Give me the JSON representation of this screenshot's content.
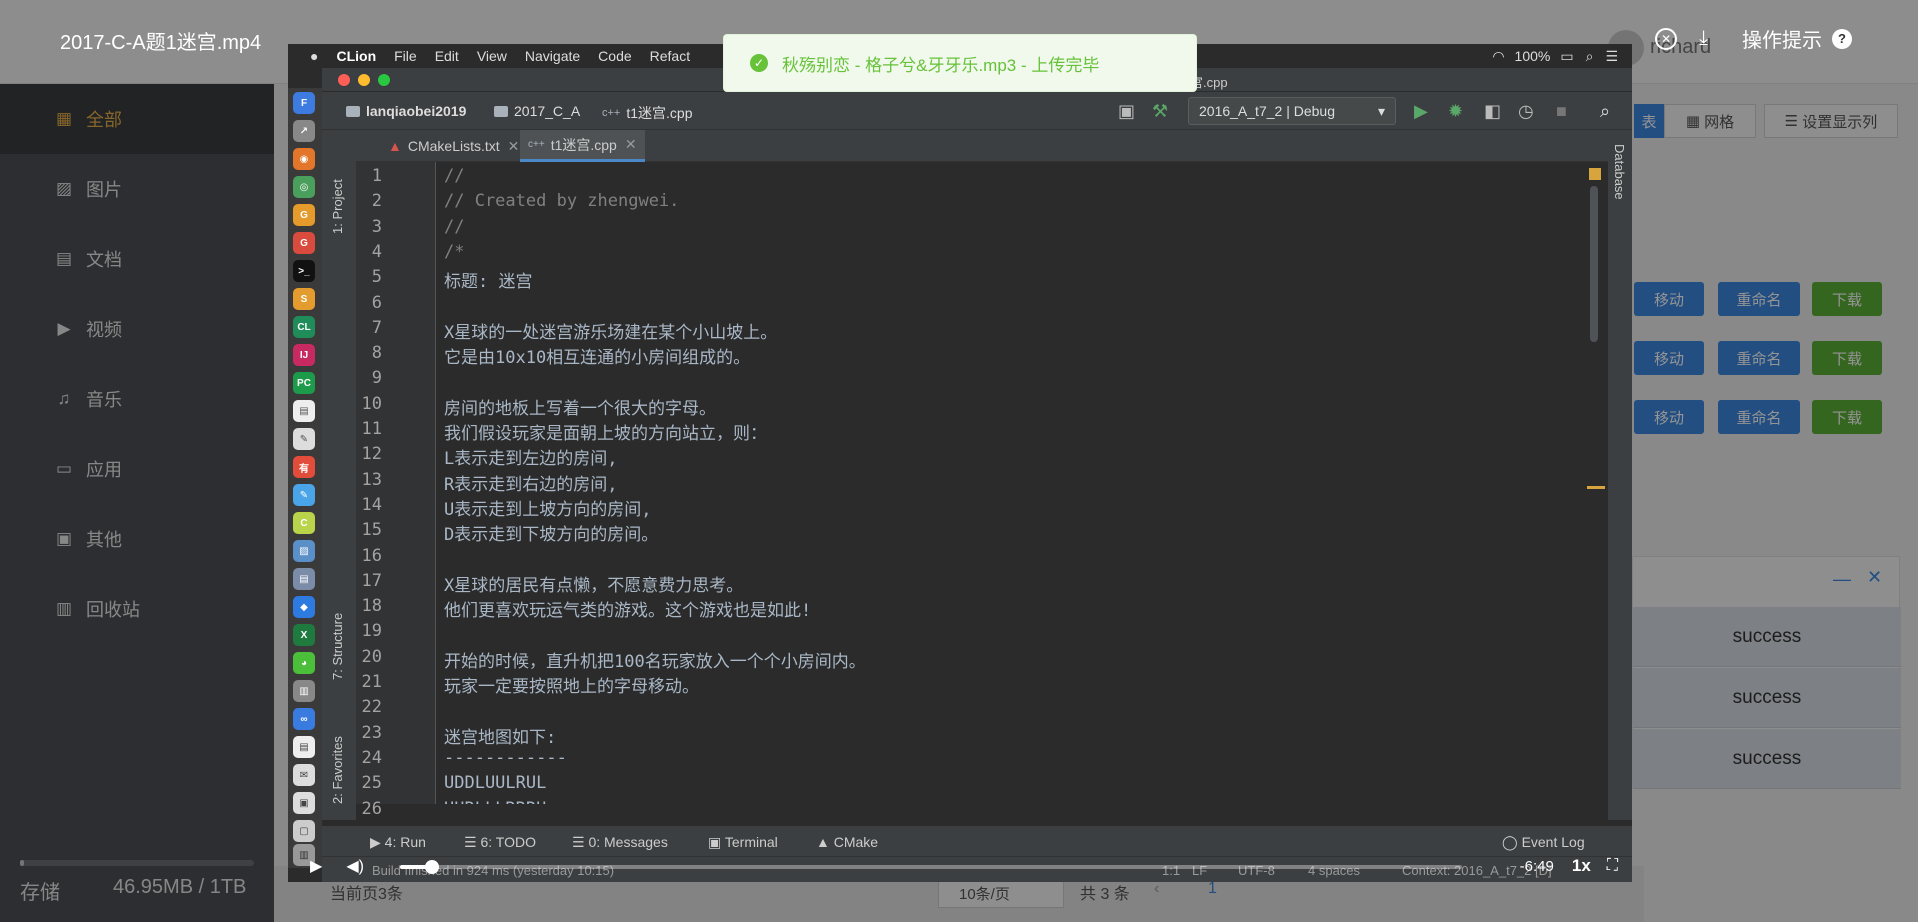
{
  "video": {
    "title": "2017-C-A题1迷宫.mp4",
    "help_label": "操作提示",
    "help_icon": "?",
    "time_remaining": "-6:49",
    "speed": "1x",
    "progress_fraction": 0.03
  },
  "toast": {
    "message": "秋殇别恋 - 格子兮&牙牙乐.mp3 - 上传完毕"
  },
  "sidebar": {
    "items": [
      {
        "icon": "grid-icon",
        "label": "全部",
        "active": true
      },
      {
        "icon": "image-icon",
        "label": "图片"
      },
      {
        "icon": "document-icon",
        "label": "文档"
      },
      {
        "icon": "video-icon",
        "label": "视频"
      },
      {
        "icon": "headphones-icon",
        "label": "音乐"
      },
      {
        "icon": "monitor-icon",
        "label": "应用"
      },
      {
        "icon": "box-icon",
        "label": "其他"
      },
      {
        "icon": "trash-icon",
        "label": "回收站"
      }
    ],
    "storage_label": "存储",
    "storage_value": "46.95MB / 1TB"
  },
  "webapp": {
    "user": "richard",
    "view_buttons": [
      "表",
      "网格",
      "设置显示列"
    ],
    "row_actions": {
      "move": "移动",
      "rename": "重命名",
      "download": "下载"
    },
    "uploads": [
      "success",
      "success",
      "success"
    ],
    "pager_current": "当前页3条",
    "page_size": "10条/页",
    "total": "共 3 条",
    "page_num": "1"
  },
  "mac_menu": [
    "CLion",
    "File",
    "Edit",
    "View",
    "Navigate",
    "Code",
    "Refact"
  ],
  "mac_status": {
    "battery": "100%"
  },
  "ide": {
    "title_file": "宫.cpp",
    "breadcrumb": [
      "lanqiaobei2019",
      "2017_C_A",
      "t1迷宫.cpp"
    ],
    "run_config": "2016_A_t7_2 | Debug",
    "tabs": [
      "CMakeLists.txt",
      "t1迷宫.cpp"
    ],
    "left_tools": [
      "1: Project",
      "7: Structure",
      "2: Favorites"
    ],
    "right_tools": [
      "Database"
    ],
    "code_lines": [
      "//",
      "// Created by zhengwei.",
      "//",
      "/*",
      "标题: 迷宫",
      "",
      "X星球的一处迷宫游乐场建在某个小山坡上。",
      "它是由10x10相互连通的小房间组成的。",
      "",
      "房间的地板上写着一个很大的字母。",
      "我们假设玩家是面朝上坡的方向站立，则：",
      "L表示走到左边的房间,",
      "R表示走到右边的房间,",
      "U表示走到上坡方向的房间,",
      "D表示走到下坡方向的房间。",
      "",
      "X星球的居民有点懒，不愿意费力思考。",
      "他们更喜欢玩运气类的游戏。这个游戏也是如此!",
      "",
      "开始的时候，直升机把100名玩家放入一个个小房间内。",
      "玩家一定要按照地上的字母移动。",
      "",
      "迷宫地图如下:",
      "------------",
      "UDDLUULRUL",
      "UURLLLRRRU"
    ],
    "bottom_tools": [
      "4: Run",
      "6: TODO",
      "0: Messages",
      "Terminal",
      "CMake",
      "Event Log"
    ],
    "status": {
      "build": "Build finished in 924 ms (yesterday 10:15)",
      "position": "1:1",
      "line_sep": "LF",
      "encoding": "UTF-8",
      "indent": "4 spaces",
      "context": "Context: 2016_A_t7_2 [D]"
    }
  }
}
